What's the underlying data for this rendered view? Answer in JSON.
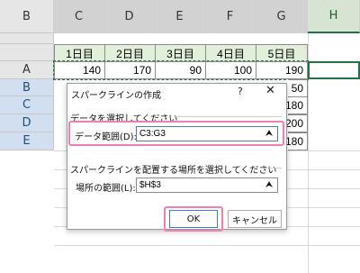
{
  "columns": [
    {
      "id": "B",
      "label": "B"
    },
    {
      "id": "C",
      "label": "C"
    },
    {
      "id": "D",
      "label": "D"
    },
    {
      "id": "E",
      "label": "E"
    },
    {
      "id": "F",
      "label": "F"
    },
    {
      "id": "G",
      "label": "G"
    },
    {
      "id": "H",
      "label": "H"
    }
  ],
  "rows": [
    "A",
    "B",
    "C",
    "D",
    "E"
  ],
  "table": {
    "headers": [
      "1日目",
      "2日目",
      "3日目",
      "4日目",
      "5日目"
    ],
    "row_a": [
      "140",
      "170",
      "90",
      "100",
      "190"
    ],
    "partial_values": [
      "50",
      "180",
      "200",
      "180"
    ]
  },
  "dialog": {
    "title": "スパークラインの作成",
    "help": "?",
    "close": "✕",
    "data_section": "データを選択してください",
    "data_range_label": "データ範囲(D):",
    "data_range_value": "C3:G3",
    "location_section": "スパークラインを配置する場所を選択してください",
    "location_label": "場所の範囲(L):",
    "location_value": "$H$3",
    "collapse_icon": "⮝",
    "ok": "OK",
    "cancel": "キャンセル"
  },
  "colors": {
    "highlight": "#f27fb2",
    "header_fill": "#e2efda",
    "excel_green": "#217346"
  }
}
